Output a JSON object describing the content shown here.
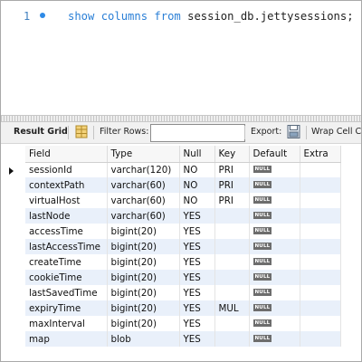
{
  "editor": {
    "line_number": "1",
    "keyword_show": "show",
    "keyword_columns": "columns",
    "keyword_from": "from",
    "target": "session_db.jettysessions;"
  },
  "toolbar": {
    "result_grid_label": "Result Grid",
    "filter_rows_label": "Filter Rows:",
    "filter_value": "",
    "export_label": "Export:",
    "wrap_label": "Wrap Cell C",
    "grid_icon": "grid-icon",
    "export_icon": "export-icon"
  },
  "grid": {
    "headers": [
      "Field",
      "Type",
      "Null",
      "Key",
      "Default",
      "Extra"
    ],
    "null_badge": "NULL",
    "rows": [
      {
        "field": "sessionId",
        "type": "varchar(120)",
        "null": "NO",
        "key": "PRI",
        "default": "NULL",
        "extra": ""
      },
      {
        "field": "contextPath",
        "type": "varchar(60)",
        "null": "NO",
        "key": "PRI",
        "default": "NULL",
        "extra": ""
      },
      {
        "field": "virtualHost",
        "type": "varchar(60)",
        "null": "NO",
        "key": "PRI",
        "default": "NULL",
        "extra": ""
      },
      {
        "field": "lastNode",
        "type": "varchar(60)",
        "null": "YES",
        "key": "",
        "default": "NULL",
        "extra": ""
      },
      {
        "field": "accessTime",
        "type": "bigint(20)",
        "null": "YES",
        "key": "",
        "default": "NULL",
        "extra": ""
      },
      {
        "field": "lastAccessTime",
        "type": "bigint(20)",
        "null": "YES",
        "key": "",
        "default": "NULL",
        "extra": ""
      },
      {
        "field": "createTime",
        "type": "bigint(20)",
        "null": "YES",
        "key": "",
        "default": "NULL",
        "extra": ""
      },
      {
        "field": "cookieTime",
        "type": "bigint(20)",
        "null": "YES",
        "key": "",
        "default": "NULL",
        "extra": ""
      },
      {
        "field": "lastSavedTime",
        "type": "bigint(20)",
        "null": "YES",
        "key": "",
        "default": "NULL",
        "extra": ""
      },
      {
        "field": "expiryTime",
        "type": "bigint(20)",
        "null": "YES",
        "key": "MUL",
        "default": "NULL",
        "extra": ""
      },
      {
        "field": "maxInterval",
        "type": "bigint(20)",
        "null": "YES",
        "key": "",
        "default": "NULL",
        "extra": ""
      },
      {
        "field": "map",
        "type": "blob",
        "null": "YES",
        "key": "",
        "default": "NULL",
        "extra": ""
      }
    ]
  },
  "colors": {
    "keyword": "#2a7fd6",
    "alt_row": "#e9f0fa",
    "null_badge_bg": "#6d6d6d"
  }
}
